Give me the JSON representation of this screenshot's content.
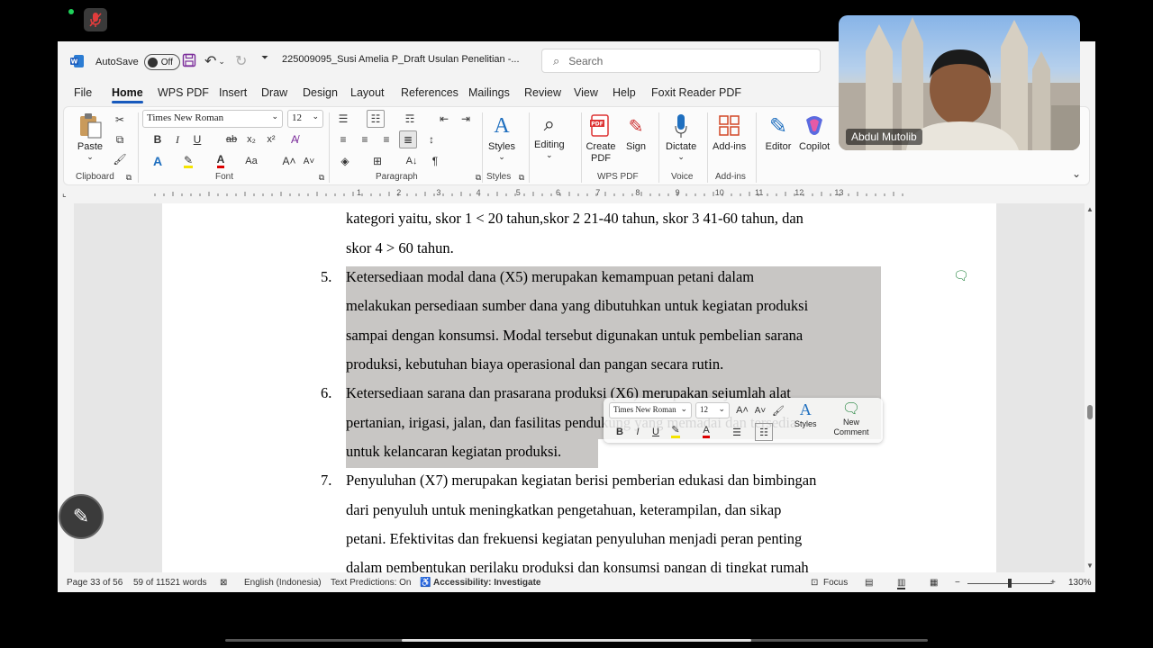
{
  "titlebar": {
    "autosave_label": "AutoSave",
    "autosave_state": "Off",
    "doc_title": "225009095_Susi Amelia P_Draft Usulan Penelitian  -...",
    "search_placeholder": "Search"
  },
  "menu": [
    "File",
    "Home",
    "WPS PDF",
    "Insert",
    "Draw",
    "Design",
    "Layout",
    "References",
    "Mailings",
    "Review",
    "View",
    "Help",
    "Foxit Reader PDF"
  ],
  "active_menu": "Home",
  "ribbon": {
    "paste": "Paste",
    "font_name": "Times New Roman",
    "font_size": "12",
    "styles": "Styles",
    "editing": "Editing",
    "create_pdf": "Create PDF",
    "sign": "Sign",
    "dictate": "Dictate",
    "add_ins": "Add-ins",
    "editor": "Editor",
    "copilot": "Copilot",
    "groups": {
      "clipboard": "Clipboard",
      "font": "Font",
      "paragraph": "Paragraph",
      "styles": "Styles",
      "wps_pdf": "WPS PDF",
      "voice": "Voice",
      "add_ins": "Add-ins"
    }
  },
  "ruler_numbers": [
    "1",
    "2",
    "3",
    "4",
    "5",
    "6",
    "7",
    "8",
    "9",
    "10",
    "11",
    "12",
    "13"
  ],
  "document": {
    "lines": [
      "kategori  yaitu,  skor  1  <  20  tahun,skor  2  21-40  tahun,  skor  3  41-60  tahun,  dan",
      "skor 4 > 60 tahun.",
      "Ketersediaan   modal   dana   (X5)   merupakan   kemampuan   petani   dalam",
      "melakukan persediaan sumber dana yang dibutuhkan untuk kegiatan produksi",
      "sampai dengan konsumsi. Modal tersebut digunakan untuk pembelian sarana",
      "produksi, kebutuhan biaya operasional dan pangan secara rutin.",
      "Ketersediaan  sarana  dan  prasarana  produksi  (X6)  merupakan  sejumlah  alat",
      "pertanian,  irigasi,  jalan,  dan  fasilitas  pendukung  yang  memadai  dan  tersedia",
      "untuk kelancaran kegiatan produksi.",
      "Penyuluhan (X7) merupakan kegiatan berisi pemberian edukasi dan bimbingan",
      "dari  penyuluh  untuk  meningkatkan  pengetahuan,  keterampilan,  dan  sikap",
      "petani. Efektivitas dan frekuensi kegiatan penyuluhan menjadi peran penting",
      "dalam pembentukan perilaku produksi dan konsumsi pangan di tingkat rumah"
    ],
    "numbers": [
      "5.",
      "6.",
      "7."
    ]
  },
  "mini_toolbar": {
    "font_name": "Times New Roman",
    "font_size": "12",
    "styles": "Styles",
    "new_comment": "New Comment"
  },
  "status": {
    "page": "Page 33 of 56",
    "words": "59 of 11521 words",
    "language": "English (Indonesia)",
    "predictions": "Text Predictions: On",
    "accessibility": "Accessibility: Investigate",
    "focus": "Focus",
    "zoom": "130%"
  },
  "video": {
    "name": "Abdul Mutolib"
  },
  "colors": {
    "accent": "#185abd",
    "highlight": "#c8c6c4",
    "word_blue": "#185abd"
  }
}
